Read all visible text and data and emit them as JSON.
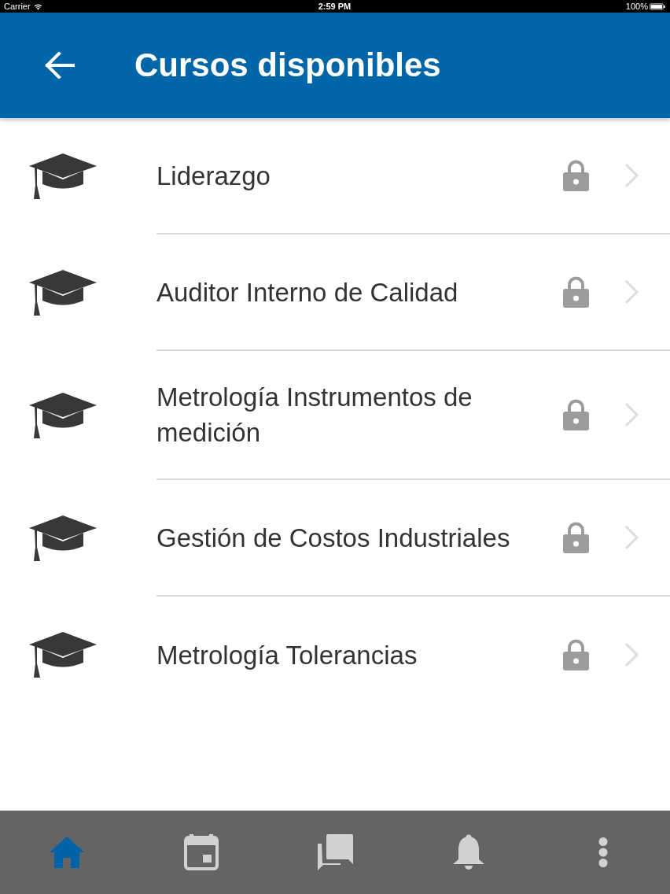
{
  "status_bar": {
    "carrier": "Carrier",
    "time": "2:59 PM",
    "battery": "100%"
  },
  "header": {
    "title": "Cursos disponibles"
  },
  "courses": [
    {
      "title": "Liderazgo",
      "locked": true
    },
    {
      "title": "Auditor Interno de Calidad",
      "locked": true
    },
    {
      "title": "Metrología Instrumentos de medición",
      "locked": true
    },
    {
      "title": "Gestión de Costos Industriales",
      "locked": true
    },
    {
      "title": "Metrología Tolerancias",
      "locked": true
    }
  ],
  "bottom_nav": [
    {
      "kind": "home",
      "selected": true
    },
    {
      "kind": "calendar",
      "selected": false
    },
    {
      "kind": "chat",
      "selected": false
    },
    {
      "kind": "bell",
      "selected": false
    },
    {
      "kind": "more",
      "selected": false
    }
  ]
}
